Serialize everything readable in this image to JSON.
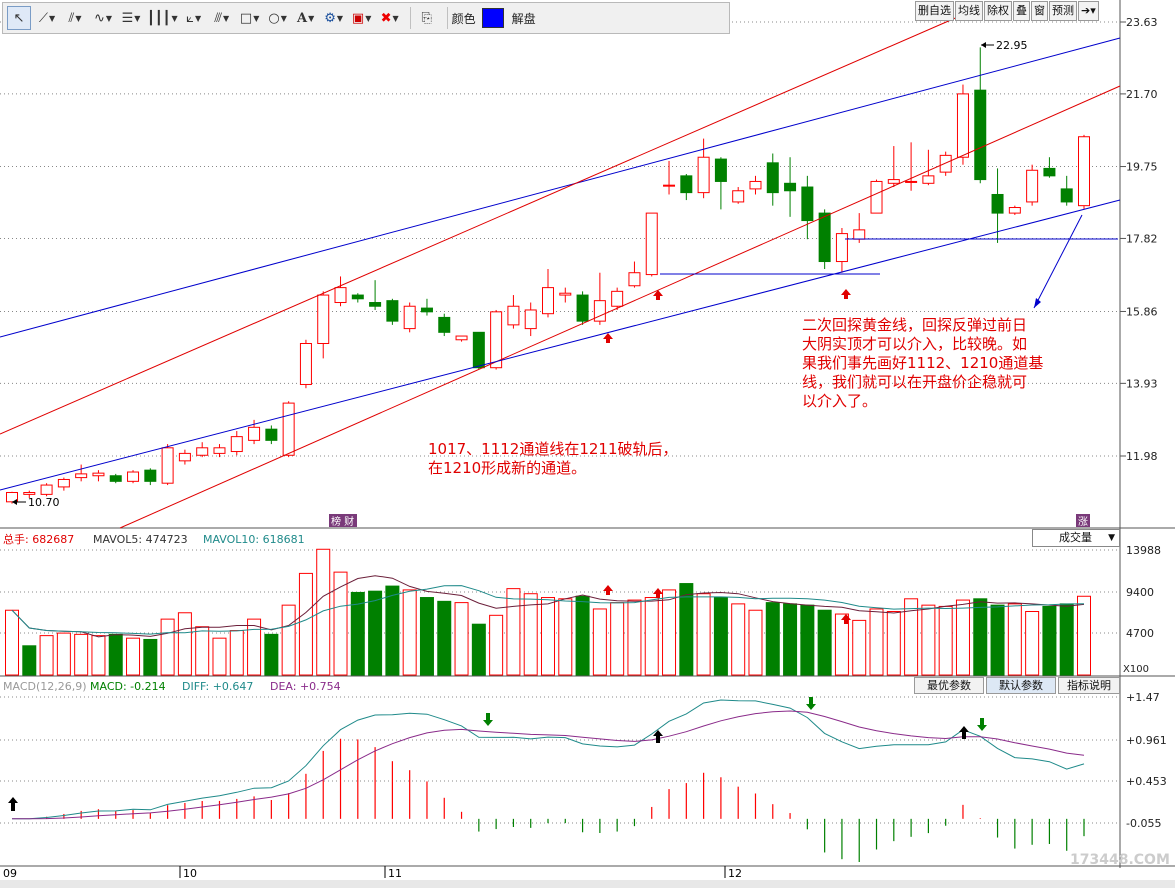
{
  "toolbar": {
    "color_label": "颜色",
    "unlock_label": "解盘",
    "tools": [
      "pointer-icon",
      "line-icon",
      "channel-icon",
      "wave-icon",
      "fib-icon",
      "cycle-icon",
      "fan-icon",
      "gann-icon",
      "rect-icon",
      "ellipse-icon",
      "text-icon",
      "settings-icon",
      "mark-icon",
      "delete-icon",
      "export-icon"
    ],
    "draw_color": "#0000ff"
  },
  "right_toolbar": [
    "删自选",
    "均线",
    "除权",
    "叠",
    "窗",
    "预测"
  ],
  "annotations": {
    "note_main": [
      "二次回探黄金线，回探反弹过前日",
      "大阴实顶才可以介入，比较晚。如",
      "果我们事先画好1112、1210通道基",
      "线，我们就可以在开盘价企稳就可",
      "以介入了。"
    ],
    "note_channel": [
      "1017、1112通道线在1211破轨后，",
      "在1210形成新的通道。"
    ],
    "high_label": "22.95",
    "low_label": "10.70"
  },
  "volume_panel": {
    "total": "总手: 682687",
    "mavol5": "MAVOL5: 474723",
    "mavol10": "MAVOL10: 618681",
    "selector": "成交量",
    "unit": "X100",
    "ticks": [
      "13988",
      "9400",
      "4700"
    ]
  },
  "macd_panel": {
    "name": "MACD(12,26,9)",
    "macd": "MACD: -0.214",
    "diff": "DIFF: +0.647",
    "dea": "DEA: +0.754",
    "buttons": [
      "最优参数",
      "默认参数",
      "指标说明"
    ],
    "ticks": [
      "+1.47",
      "+0.961",
      "+0.453",
      "-0.055"
    ]
  },
  "price_ticks": [
    "23.63",
    "21.70",
    "19.75",
    "17.82",
    "15.86",
    "13.93",
    "11.98"
  ],
  "month_labels": [
    "09",
    "10",
    "11",
    "12"
  ],
  "badges": {
    "left": "榜 财",
    "right": "涨"
  },
  "watermark": "173448.COM",
  "colors": {
    "up": "#ff0000",
    "down": "#008000",
    "channel_red": "#e00000",
    "channel_blue": "#0000cc",
    "dif": "#1f8a8a",
    "dea": "#8a2b8a"
  },
  "chart_data": {
    "type": "candlestick",
    "price_range": [
      10.2,
      23.9
    ],
    "candles": [
      [
        10.75,
        11.0,
        10.7,
        11.02
      ],
      [
        10.95,
        11.0,
        10.85,
        11.05
      ],
      [
        10.95,
        11.2,
        10.9,
        11.25
      ],
      [
        11.15,
        11.35,
        11.05,
        11.4
      ],
      [
        11.4,
        11.5,
        11.3,
        11.75
      ],
      [
        11.45,
        11.52,
        11.3,
        11.6
      ],
      [
        11.45,
        11.3,
        11.25,
        11.5
      ],
      [
        11.3,
        11.55,
        11.25,
        11.6
      ],
      [
        11.6,
        11.3,
        11.2,
        11.65
      ],
      [
        11.25,
        12.2,
        11.2,
        12.3
      ],
      [
        11.85,
        12.05,
        11.75,
        12.15
      ],
      [
        12.0,
        12.2,
        11.95,
        12.35
      ],
      [
        12.05,
        12.2,
        11.95,
        12.3
      ],
      [
        12.1,
        12.5,
        12.0,
        12.65
      ],
      [
        12.4,
        12.75,
        12.3,
        12.95
      ],
      [
        12.7,
        12.4,
        12.3,
        12.8
      ],
      [
        12.0,
        13.4,
        11.95,
        13.45
      ],
      [
        13.9,
        15.0,
        13.8,
        15.1
      ],
      [
        15.0,
        16.3,
        14.6,
        16.4
      ],
      [
        16.1,
        16.5,
        16.0,
        16.8
      ],
      [
        16.3,
        16.2,
        16.1,
        16.35
      ],
      [
        16.1,
        16.0,
        15.9,
        16.7
      ],
      [
        16.15,
        15.6,
        15.5,
        16.2
      ],
      [
        15.4,
        16.0,
        15.3,
        16.1
      ],
      [
        15.95,
        15.85,
        15.75,
        16.2
      ],
      [
        15.7,
        15.3,
        15.2,
        15.8
      ],
      [
        15.1,
        15.2,
        15.05,
        15.2
      ],
      [
        15.3,
        14.35,
        14.3,
        15.3
      ],
      [
        14.35,
        15.85,
        14.3,
        15.9
      ],
      [
        15.5,
        16.0,
        15.4,
        16.3
      ],
      [
        15.4,
        15.9,
        15.2,
        16.1
      ],
      [
        15.8,
        16.5,
        15.7,
        17.0
      ],
      [
        16.3,
        16.35,
        16.1,
        16.5
      ],
      [
        16.3,
        15.6,
        15.5,
        16.4
      ],
      [
        15.6,
        16.15,
        15.5,
        16.9
      ],
      [
        16.0,
        16.4,
        15.9,
        16.5
      ],
      [
        16.55,
        16.9,
        16.5,
        17.2
      ],
      [
        16.85,
        18.5,
        16.8,
        18.5
      ],
      [
        19.25,
        19.25,
        19.0,
        19.9
      ],
      [
        19.5,
        19.05,
        18.85,
        19.55
      ],
      [
        19.05,
        20.0,
        18.9,
        20.5
      ],
      [
        19.95,
        19.35,
        18.6,
        20.0
      ],
      [
        18.8,
        19.1,
        18.75,
        19.2
      ],
      [
        19.15,
        19.35,
        19.0,
        19.5
      ],
      [
        19.85,
        19.05,
        18.7,
        20.1
      ],
      [
        19.3,
        19.1,
        18.4,
        20.0
      ],
      [
        19.2,
        18.3,
        17.8,
        19.5
      ],
      [
        18.5,
        17.2,
        17.0,
        18.6
      ],
      [
        17.2,
        17.95,
        16.9,
        18.1
      ],
      [
        17.8,
        18.05,
        17.7,
        18.5
      ],
      [
        18.5,
        19.35,
        18.5,
        19.4
      ],
      [
        19.3,
        19.4,
        19.2,
        20.3
      ],
      [
        19.35,
        19.35,
        19.1,
        20.4
      ],
      [
        19.3,
        19.5,
        19.25,
        20.2
      ],
      [
        19.6,
        20.05,
        19.5,
        20.15
      ],
      [
        20.0,
        21.7,
        19.8,
        21.95
      ],
      [
        21.8,
        19.4,
        19.3,
        22.95
      ],
      [
        19.0,
        18.5,
        17.7,
        19.7
      ],
      [
        18.5,
        18.65,
        18.45,
        18.7
      ],
      [
        18.8,
        19.65,
        18.7,
        19.8
      ],
      [
        19.7,
        19.5,
        19.45,
        20.0
      ],
      [
        19.15,
        18.8,
        18.7,
        19.5
      ],
      [
        18.7,
        20.55,
        18.6,
        20.6
      ]
    ],
    "volume": [
      51,
      23,
      31,
      33,
      32,
      31,
      32,
      29,
      28,
      44,
      49,
      38,
      29,
      35,
      44,
      32,
      55,
      80,
      99,
      81,
      65,
      66,
      70,
      67,
      61,
      58,
      57,
      40,
      47,
      68,
      64,
      61,
      60,
      62,
      52,
      57,
      59,
      61,
      67,
      72,
      64,
      61,
      56,
      51,
      57,
      56,
      55,
      51,
      48,
      43,
      52,
      50,
      60,
      55,
      54,
      59,
      60,
      55,
      56,
      50,
      54,
      56,
      62
    ],
    "volume_up": [
      true,
      false,
      true,
      true,
      true,
      true,
      false,
      true,
      false,
      true,
      true,
      true,
      true,
      true,
      true,
      false,
      true,
      true,
      true,
      true,
      false,
      false,
      false,
      true,
      false,
      false,
      true,
      false,
      true,
      true,
      true,
      true,
      true,
      false,
      true,
      true,
      true,
      true,
      true,
      false,
      true,
      false,
      true,
      true,
      false,
      false,
      false,
      false,
      true,
      true,
      true,
      true,
      true,
      true,
      true,
      true,
      false,
      false,
      true,
      true,
      false,
      false,
      true
    ]
  }
}
